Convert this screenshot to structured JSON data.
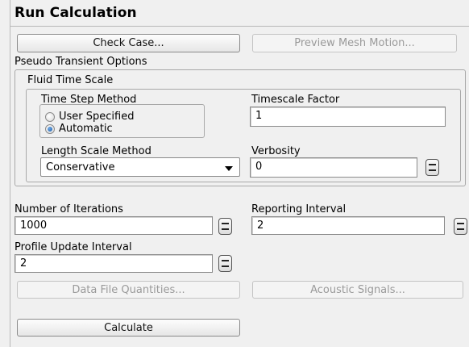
{
  "panel": {
    "title": "Run Calculation",
    "check_case_label": "Check Case...",
    "preview_mesh_label": "Preview Mesh Motion...",
    "pseudo_transient_label": "Pseudo Transient Options",
    "fluid_time_scale_label": "Fluid Time Scale",
    "time_step_method_label": "Time Step Method",
    "time_step_options": [
      {
        "label": "User Specified",
        "selected": false
      },
      {
        "label": "Automatic",
        "selected": true
      }
    ],
    "timescale_factor_label": "Timescale Factor",
    "timescale_factor_value": "1",
    "length_scale_method_label": "Length Scale Method",
    "length_scale_method_value": "Conservative",
    "verbosity_label": "Verbosity",
    "verbosity_value": "0",
    "iterations_label": "Number of Iterations",
    "iterations_value": "1000",
    "reporting_interval_label": "Reporting Interval",
    "reporting_interval_value": "2",
    "profile_update_label": "Profile Update Interval",
    "profile_update_value": "2",
    "data_file_quantities_label": "Data File Quantities...",
    "acoustic_signals_label": "Acoustic Signals...",
    "calculate_label": "Calculate"
  }
}
